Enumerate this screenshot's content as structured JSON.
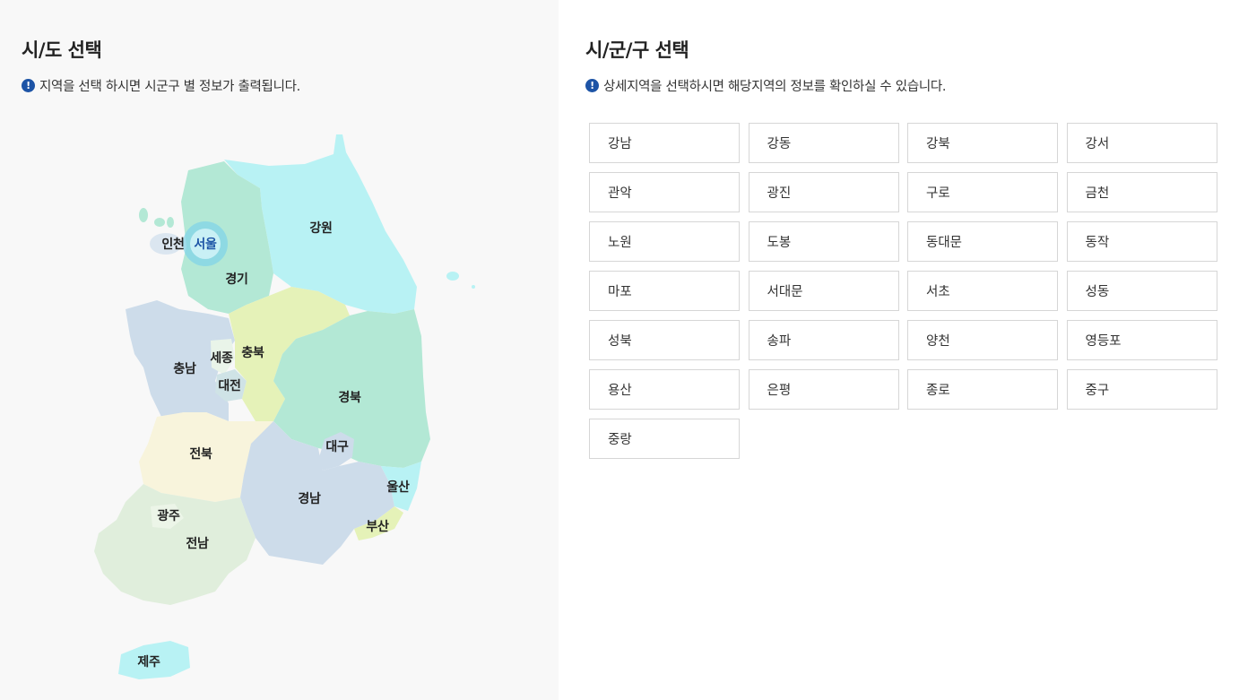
{
  "sido_panel": {
    "title": "시/도 선택",
    "notice": "지역을 선택 하시면 시군구 별 정보가 출력됩니다.",
    "notice_icon": "exclamation-circle-icon"
  },
  "sigungu_panel": {
    "title": "시/군/구 선택",
    "notice": "상세지역을 선택하시면 해당지역의 정보를 확인하실 수 있습니다.",
    "notice_icon": "exclamation-circle-icon"
  },
  "colors": {
    "accent": "#1d54a6",
    "selected_marker": "#7fd3e8",
    "panel_bg": "#f8f8f8"
  },
  "map": {
    "selected": "서울",
    "regions": {
      "seoul": "서울",
      "incheon": "인천",
      "gyeonggi": "경기",
      "gangwon": "강원",
      "chungbuk": "충북",
      "chungnam": "충남",
      "sejong": "세종",
      "daejeon": "대전",
      "gyeongbuk": "경북",
      "daegu": "대구",
      "jeonbuk": "전북",
      "gyeongnam": "경남",
      "ulsan": "울산",
      "busan": "부산",
      "gwangju": "광주",
      "jeonnam": "전남",
      "jeju": "제주"
    }
  },
  "districts": [
    "강남",
    "강동",
    "강북",
    "강서",
    "관악",
    "광진",
    "구로",
    "금천",
    "노원",
    "도봉",
    "동대문",
    "동작",
    "마포",
    "서대문",
    "서초",
    "성동",
    "성북",
    "송파",
    "양천",
    "영등포",
    "용산",
    "은평",
    "종로",
    "중구",
    "중랑"
  ]
}
